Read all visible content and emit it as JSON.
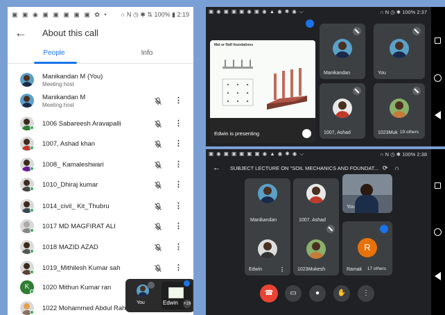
{
  "left": {
    "status": {
      "icons": "▣ ▣ ◉ ▣ ▣ ▣ ▣ ▣ ✿ •",
      "right_icons": "∩ N ◷ ✱ ⇅",
      "battery": "100%",
      "time": "2:19"
    },
    "title": "About this call",
    "tabs": [
      "People",
      "Info"
    ],
    "participants": [
      {
        "name": "Manikandan M (You)",
        "sub": "Meeting host"
      },
      {
        "name": "Manikandan M",
        "sub": "Meeting host"
      },
      {
        "name": "1006 Sabareesh Aravapalli"
      },
      {
        "name": "1007, Ashad khan"
      },
      {
        "name": "1008_ Kamaleshwari"
      },
      {
        "name": "1010_Dhiraj kumar"
      },
      {
        "name": "1014_civil_ Kit_Thubru"
      },
      {
        "name": "1017 MD MAGFIRAT ALI"
      },
      {
        "name": "1018 MAZID AZAD"
      },
      {
        "name": "1019_Mithilesh Kumar sah"
      },
      {
        "name": "1020 Mithun Kumar ran",
        "initial": "K"
      },
      {
        "name": "1022 Mohammed Abdul Rahim"
      }
    ],
    "pip": {
      "you": "You",
      "edwin": "Edwin",
      "count": "+19"
    }
  },
  "top": {
    "status": {
      "icons": "▣ ◉ ▣ ▣ ▣ ◉ ▣ ◉ ▲ ◉ ✱ ◉ ⌵",
      "right_icons": "∩ N ◷ ✱",
      "battery": "100%",
      "time": "2:37"
    },
    "slide_title": "Mat or Raft foundations",
    "presenting": "Edwin is presenting",
    "tiles": [
      {
        "name": "Manikandan"
      },
      {
        "name": "You"
      },
      {
        "name": "1007, Ashad"
      },
      {
        "name": "1023Muk",
        "others": "19 others"
      }
    ]
  },
  "bottom": {
    "status": {
      "icons": "▣ ◉ ▣ ▣ ▣ ▣ ▣ ◉ ▲ ◉ ✱ ◉ ⌵",
      "right_icons": "∩ N ◷ ✱",
      "battery": "100%",
      "time": "2:38"
    },
    "title": "SUBJECT LECTURE ON \"SOIL MECHANICS AND FOUNDAT...",
    "tiles": [
      {
        "name": "Manikandan"
      },
      {
        "name": "1007, Ashad"
      },
      {
        "name": "You"
      },
      {
        "name": "Edwin"
      },
      {
        "name": "1023Mukesh"
      },
      {
        "name": "Ramak",
        "others": "17 others",
        "initial": "R"
      }
    ]
  },
  "colors": {
    "accent": "#1a73e8",
    "end_call": "#ea4335",
    "online": "#34a853"
  }
}
